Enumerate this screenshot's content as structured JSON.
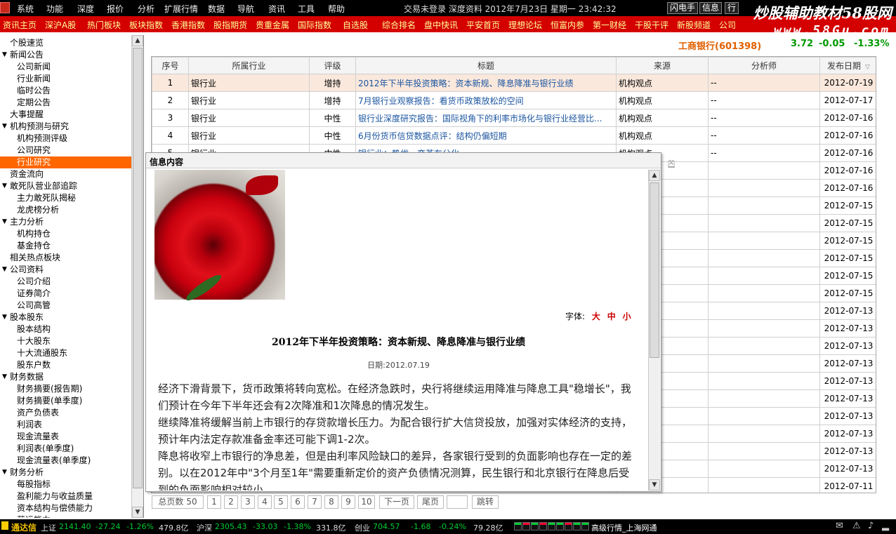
{
  "menu": {
    "items": [
      "系统",
      "功能",
      "深度",
      "报价",
      "分析",
      "扩展行情",
      "数据",
      "导航",
      "资讯",
      "工具",
      "帮助"
    ],
    "status": "交易未登录  深度资料 2012年7月23日 星期一 23:42:32",
    "buttons": [
      "闪电手",
      "信息",
      "行"
    ]
  },
  "brand": {
    "line1": "炒股辅助教材58股网",
    "line2": "www.58Gu.com"
  },
  "tabs": [
    "资讯主页",
    "深沪A股",
    "热门板块",
    "板块指数",
    "香港指数",
    "股指期货",
    "贵重金属",
    "国际指数",
    "自选股",
    "综合排名",
    "盘中快讯",
    "平安首页",
    "理想论坛",
    "恒富内参",
    "第一财经",
    "干股干评",
    "新股频道",
    "公司"
  ],
  "quote": {
    "name": "工商银行(601398)",
    "price": "3.72",
    "change": "-0.05",
    "pct": "-1.33%"
  },
  "sidebar": [
    {
      "label": "个股速览",
      "level": "p",
      "tog": ""
    },
    {
      "label": "新闻公告",
      "level": "p",
      "tog": "▼"
    },
    {
      "label": "公司新闻",
      "level": "c"
    },
    {
      "label": "行业新闻",
      "level": "c"
    },
    {
      "label": "临时公告",
      "level": "c"
    },
    {
      "label": "定期公告",
      "level": "c"
    },
    {
      "label": "大事提醒",
      "level": "p",
      "tog": ""
    },
    {
      "label": "机构预测与研究",
      "level": "p",
      "tog": "▼"
    },
    {
      "label": "机构预测评级",
      "level": "c"
    },
    {
      "label": "公司研究",
      "level": "c"
    },
    {
      "label": "行业研究",
      "level": "c",
      "selected": true
    },
    {
      "label": "资金流向",
      "level": "p",
      "tog": ""
    },
    {
      "label": "敢死队营业部追踪",
      "level": "p",
      "tog": "▼"
    },
    {
      "label": "主力敢死队揭秘",
      "level": "c"
    },
    {
      "label": "龙虎榜分析",
      "level": "c"
    },
    {
      "label": "主力分析",
      "level": "p",
      "tog": "▼"
    },
    {
      "label": "机构持仓",
      "level": "c"
    },
    {
      "label": "基金持仓",
      "level": "c"
    },
    {
      "label": "相关热点板块",
      "level": "p",
      "tog": ""
    },
    {
      "label": "公司资料",
      "level": "p",
      "tog": "▼"
    },
    {
      "label": "公司介绍",
      "level": "c"
    },
    {
      "label": "证券简介",
      "level": "c"
    },
    {
      "label": "公司高管",
      "level": "c"
    },
    {
      "label": "股本股东",
      "level": "p",
      "tog": "▼"
    },
    {
      "label": "股本结构",
      "level": "c"
    },
    {
      "label": "十大股东",
      "level": "c"
    },
    {
      "label": "十大流通股东",
      "level": "c"
    },
    {
      "label": "股东户数",
      "level": "c"
    },
    {
      "label": "财务数据",
      "level": "p",
      "tog": "▼"
    },
    {
      "label": "财务摘要(报告期)",
      "level": "c"
    },
    {
      "label": "财务摘要(单季度)",
      "level": "c"
    },
    {
      "label": "资产负债表",
      "level": "c"
    },
    {
      "label": "利润表",
      "level": "c"
    },
    {
      "label": "现金流量表",
      "level": "c"
    },
    {
      "label": "利润表(单季度)",
      "level": "c"
    },
    {
      "label": "现金流量表(单季度)",
      "level": "c"
    },
    {
      "label": "财务分析",
      "level": "p",
      "tog": "▼"
    },
    {
      "label": "每股指标",
      "level": "c"
    },
    {
      "label": "盈利能力与收益质量",
      "level": "c"
    },
    {
      "label": "资本结构与偿债能力",
      "level": "c"
    },
    {
      "label": "营运能力",
      "level": "c"
    }
  ],
  "table": {
    "headers": [
      "序号",
      "所属行业",
      "评级",
      "标题",
      "来源",
      "分析师",
      "发布日期"
    ],
    "sort_indicator": "▽",
    "rows": [
      {
        "no": "1",
        "industry": "银行业",
        "rating": "增持",
        "title": "2012年下半年投资策略：资本新规、降息降准与银行业绩",
        "source": "机构观点",
        "analyst": "--",
        "date": "2012-07-19"
      },
      {
        "no": "2",
        "industry": "银行业",
        "rating": "增持",
        "title": "7月银行业观察报告：看货币政策放松的空间",
        "source": "机构观点",
        "analyst": "--",
        "date": "2012-07-17"
      },
      {
        "no": "3",
        "industry": "银行业",
        "rating": "中性",
        "title": "银行业深度研究报告：国际视角下的利率市场化与银行业经营比...",
        "source": "机构观点",
        "analyst": "--",
        "date": "2012-07-16"
      },
      {
        "no": "4",
        "industry": "银行业",
        "rating": "中性",
        "title": "6月份货币信贷数据点评：结构仍偏短期",
        "source": "机构观点",
        "analyst": "--",
        "date": "2012-07-16"
      },
      {
        "no": "5",
        "industry": "银行业",
        "rating": "中性",
        "title": "银行业：势优、变革有分化",
        "source": "机构观点",
        "analyst": "--",
        "date": "2012-07-16"
      },
      {
        "no": "",
        "industry": "",
        "rating": "",
        "title": "",
        "source": "",
        "analyst": "",
        "date": "2012-07-16"
      },
      {
        "no": "",
        "industry": "",
        "rating": "",
        "title": "",
        "source": "",
        "analyst": "",
        "date": "2012-07-16"
      },
      {
        "no": "",
        "industry": "",
        "rating": "",
        "title": "",
        "source": "",
        "analyst": "",
        "date": "2012-07-15"
      },
      {
        "no": "",
        "industry": "",
        "rating": "",
        "title": "",
        "source": "",
        "analyst": "",
        "date": "2012-07-15"
      },
      {
        "no": "",
        "industry": "",
        "rating": "",
        "title": "",
        "source": "",
        "analyst": "",
        "date": "2012-07-15"
      },
      {
        "no": "",
        "industry": "",
        "rating": "",
        "title": "",
        "source": "",
        "analyst": "",
        "date": "2012-07-15"
      },
      {
        "no": "",
        "industry": "",
        "rating": "",
        "title": "",
        "source": "",
        "analyst": "",
        "date": "2012-07-15"
      },
      {
        "no": "",
        "industry": "",
        "rating": "",
        "title": "",
        "source": "",
        "analyst": "",
        "date": "2012-07-15"
      },
      {
        "no": "",
        "industry": "",
        "rating": "",
        "title": "",
        "source": "",
        "analyst": "",
        "date": "2012-07-13"
      },
      {
        "no": "",
        "industry": "",
        "rating": "",
        "title": "",
        "source": "",
        "analyst": "",
        "date": "2012-07-13"
      },
      {
        "no": "",
        "industry": "",
        "rating": "",
        "title": "",
        "source": "",
        "analyst": "",
        "date": "2012-07-13"
      },
      {
        "no": "",
        "industry": "",
        "rating": "",
        "title": "",
        "source": "",
        "analyst": "",
        "date": "2012-07-13"
      },
      {
        "no": "",
        "industry": "",
        "rating": "",
        "title": "",
        "source": "",
        "analyst": "",
        "date": "2012-07-13"
      },
      {
        "no": "",
        "industry": "",
        "rating": "",
        "title": "",
        "source": "",
        "analyst": "",
        "date": "2012-07-13"
      },
      {
        "no": "",
        "industry": "",
        "rating": "",
        "title": "",
        "source": "",
        "analyst": "",
        "date": "2012-07-13"
      },
      {
        "no": "",
        "industry": "",
        "rating": "",
        "title": "",
        "source": "",
        "analyst": "",
        "date": "2012-07-13"
      },
      {
        "no": "",
        "industry": "",
        "rating": "",
        "title": "",
        "source": "",
        "analyst": "",
        "date": "2012-07-13"
      },
      {
        "no": "",
        "industry": "",
        "rating": "",
        "title": "",
        "source": "",
        "analyst": "",
        "date": "2012-07-13"
      },
      {
        "no": "",
        "industry": "",
        "rating": "",
        "title": "",
        "source": "",
        "analyst": "",
        "date": "2012-07-11"
      }
    ]
  },
  "pager": {
    "total_label": "总页数",
    "total": "50",
    "pages": [
      "1",
      "2",
      "3",
      "4",
      "5",
      "6",
      "7",
      "8",
      "9",
      "10"
    ],
    "next": "下一页",
    "last": "尾页",
    "go": "跳转"
  },
  "popup": {
    "title": "信息内容",
    "font_label": "字体:",
    "font_sizes": [
      "大",
      "中",
      "小"
    ],
    "article_title": "2012年下半年投资策略：资本新规、降息降准与银行业绩",
    "article_date": "日期:2012.07.19",
    "paragraphs": [
      "经济下滑背景下，货币政策将转向宽松。在经济急跌时，央行将继续运用降准与降息工具\"稳增长\"，我们预计在今年下半年还会有2次降准和1次降息的情况发生。",
      "继续降准将缓解当前上市银行的存贷款增长压力。为配合银行扩大信贷投放，加强对实体经济的支持，预计年内法定存款准备金率还可能下调1-2次。",
      "降息将收窄上市银行的净息差，但是由利率风险缺口的差异，各家银行受到的负面影响也存在一定的差别。以在2012年中\"3个月至1年\"需要重新定价的资产负债情况测算，民生银行和北京银行在降息后受到的负面影响相对较小。"
    ]
  },
  "statusbar": {
    "app": "通达信",
    "sh_label": "上证",
    "sh": "2141.40",
    "sh_chg": "-27.24",
    "sh_pct": "-1.26%",
    "sh_amt": "479.8亿",
    "sz_label": "沪深",
    "sz": "2305.43",
    "sz_chg": "-33.03",
    "sz_pct": "-1.38%",
    "sz_amt": "331.8亿",
    "cy_label": "创业",
    "cy": "704.57",
    "cy_chg": "-1.68",
    "cy_pct": "-0.24%",
    "cy_amt": "79.28亿",
    "feed": "高级行情_上海网通"
  },
  "colors": {
    "menubar": "#000000",
    "tabbar": "#d40000",
    "selected": "#ff6600",
    "link": "#1b55a0",
    "down": "#00cc33"
  }
}
